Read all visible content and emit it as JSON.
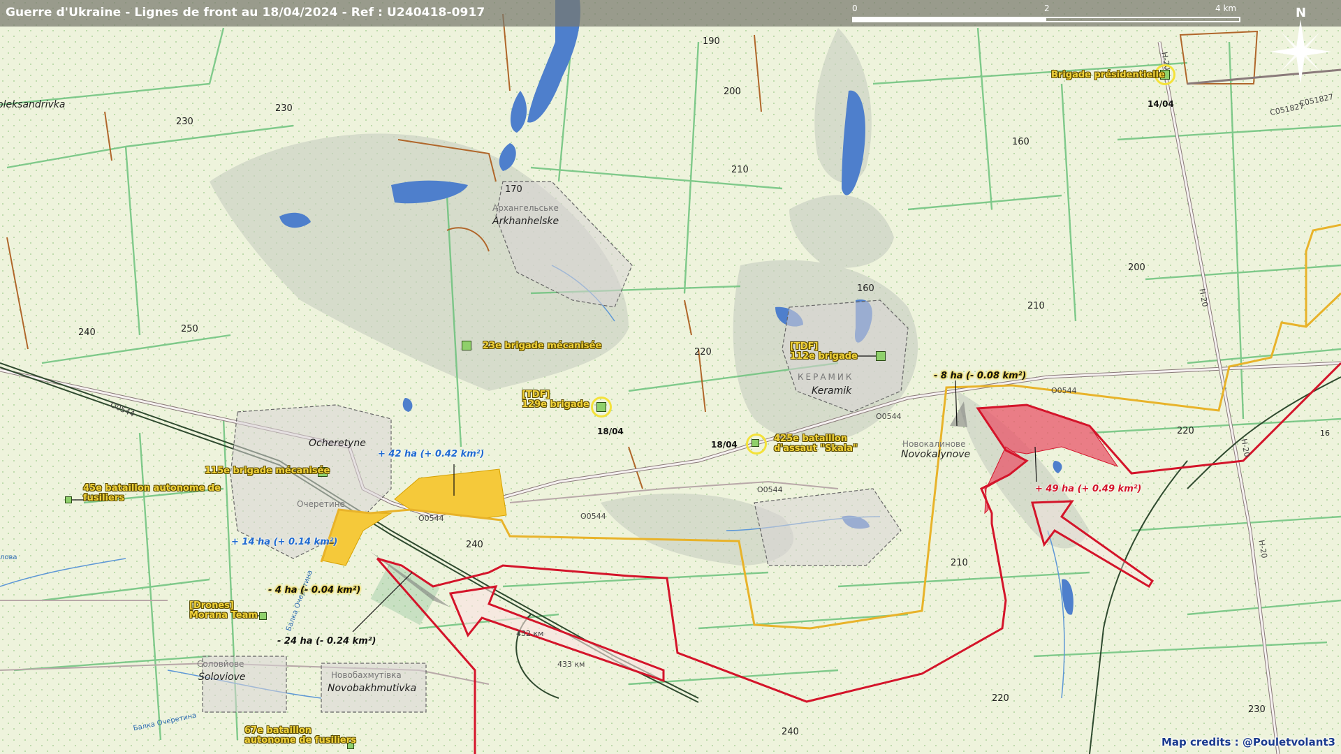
{
  "header": {
    "title": "Guerre d'Ukraine - Lignes de front au 18/04/2024 - Ref : U240418-0917"
  },
  "scale": {
    "labels": [
      "0",
      "2",
      "4 km"
    ]
  },
  "north_label": "N",
  "colors": {
    "ukraine_front": "#e8b32a",
    "russia_front": "#d4142a",
    "ukraine_gain": "#f5c93a",
    "russia_gain": "#e8556a",
    "water": "#4e7fcc",
    "roads": "#8a7a7a",
    "fields": "#57b86a"
  },
  "places": [
    {
      "name": "Arkhanhelske",
      "cyr": "Архангельське"
    },
    {
      "name": "Keramik",
      "cyr": "КЕРАМИК"
    },
    {
      "name": "Ocheretyne",
      "cyr": "Очеретине"
    },
    {
      "name": "Novokalynove",
      "cyr": "Новокалинове"
    },
    {
      "name": "Soloviove",
      "cyr": "Соловйове"
    },
    {
      "name": "Novobakhmutivka",
      "cyr": "Новобахмутівка"
    },
    {
      "name": "oleksandrivka",
      "cyr": ""
    }
  ],
  "altitudes": [
    "190",
    "200",
    "230",
    "230",
    "170",
    "210",
    "160",
    "160",
    "200",
    "210",
    "240",
    "250",
    "220",
    "220",
    "240",
    "210",
    "220",
    "240",
    "230"
  ],
  "roads": [
    "O0544",
    "O0544",
    "O0544",
    "O0544",
    "O0544",
    "O0544",
    "C051827",
    "C051827",
    "H-20",
    "H-20",
    "H-20",
    "H-20",
    "432 км",
    "433 км"
  ],
  "water_labels": [
    "Балка Очеретина",
    "Балка Очеретина",
    "лова"
  ],
  "units": [
    {
      "name": "Brigade présidentielle",
      "date": "14/04"
    },
    {
      "name": "23e brigade mécanisée"
    },
    {
      "tag": "[TDF]",
      "name": "129e brigade",
      "date": "18/04"
    },
    {
      "tag": "[TDF]",
      "name": "112e brigade"
    },
    {
      "name": "425e bataillon",
      "name2": "d'assaut \"Skala\"",
      "date": "18/04"
    },
    {
      "name": "115e brigade mécanisée"
    },
    {
      "name": "45e bataillon autonome de",
      "name2": "fusiliers"
    },
    {
      "tag": "[Drones]",
      "name": "Morana Team"
    },
    {
      "name": "67e bataillon",
      "name2": "autonome de fusiliers"
    }
  ],
  "changes": {
    "ua_gain_1": "+ 42 ha (+ 0.42 km²)",
    "ua_gain_2": "+ 14 ha (+ 0.14 km²)",
    "ua_loss_1": "- 4 ha (- 0.04 km²)",
    "ua_loss_2": "- 24 ha (- 0.24 km²)",
    "ua_loss_3": "- 8 ha (- 0.08 km²)",
    "ru_gain_1": "+ 49 ha (+ 0.49 km²)"
  },
  "edge_label": "16",
  "credits": "Map credits : @Pouletvolant3"
}
